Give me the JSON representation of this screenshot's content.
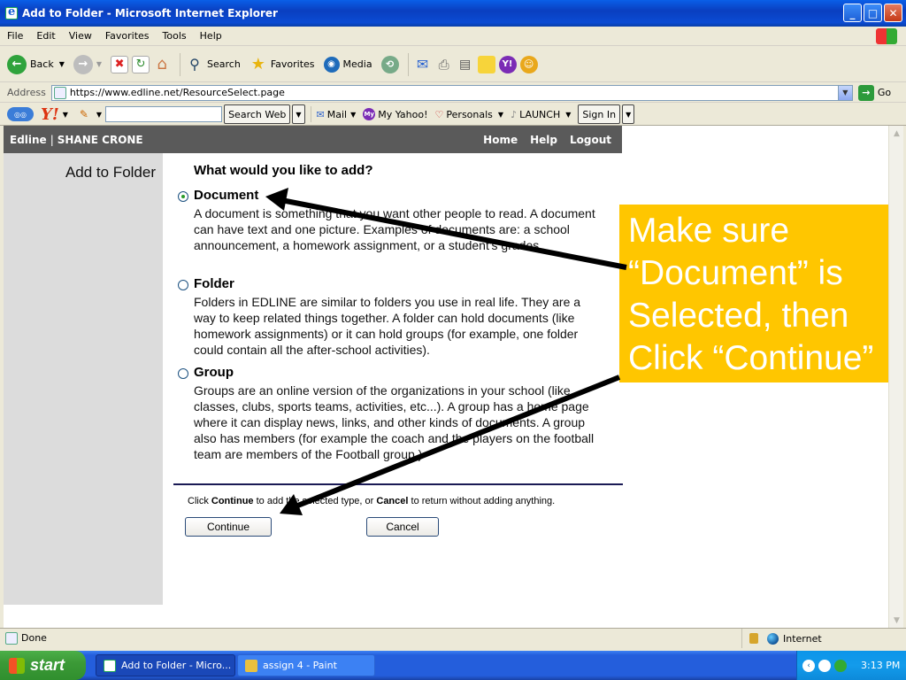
{
  "window": {
    "title": "Add to Folder - Microsoft Internet Explorer"
  },
  "menu": [
    "File",
    "Edit",
    "View",
    "Favorites",
    "Tools",
    "Help"
  ],
  "toolbar": {
    "back": "Back",
    "search": "Search",
    "favorites": "Favorites",
    "media": "Media"
  },
  "address": {
    "label": "Address",
    "url": "https://www.edline.net/ResourceSelect.page",
    "go": "Go"
  },
  "yahoo": {
    "search_web": "Search Web",
    "mail": "Mail",
    "my_yahoo": "My Yahoo!",
    "personals": "Personals",
    "launch": "LAUNCH",
    "sign_in": "Sign In"
  },
  "page": {
    "brand": "Edline",
    "user": "SHANE CRONE",
    "nav": [
      "Home",
      "Help",
      "Logout"
    ],
    "panel_title": "Add to Folder",
    "question": "What would you like to add?",
    "options": [
      {
        "title": "Document",
        "description": "A document is something that you want other people to read. A document can have text and one picture. Examples of documents are: a school announcement, a homework assignment, or a student's grades."
      },
      {
        "title": "Folder",
        "description": "Folders in EDLINE are similar to folders you use in real life. They are a way to keep related things together. A folder can hold documents (like homework assignments) or it can hold groups (for example, one folder could contain all the after-school activities)."
      },
      {
        "title": "Group",
        "description": "Groups are an online version of the organizations in your school (like classes, clubs, sports teams, activities, etc...). A group has a home page where it can display news, links, and other kinds of documents. A group also has members (for example the coach and the players on the football team are members of the Football group.)"
      }
    ],
    "selected_option": "Document",
    "instructions": {
      "pre": "Click ",
      "continue": "Continue",
      "mid": " to add the selected type, or ",
      "cancel": "Cancel",
      "post": " to return without adding anything."
    },
    "continue_button": "Continue",
    "cancel_button": "Cancel"
  },
  "callout": {
    "text_lines": [
      "Make sure",
      "“Document” is",
      "Selected, then",
      "Click “Continue”"
    ],
    "color": "#FFC600"
  },
  "status": {
    "text": "Done",
    "zone": "Internet"
  },
  "taskbar": {
    "start": "start",
    "tasks": [
      "Add to Folder - Micro...",
      "assign 4 - Paint"
    ],
    "time": "3:13 PM"
  }
}
